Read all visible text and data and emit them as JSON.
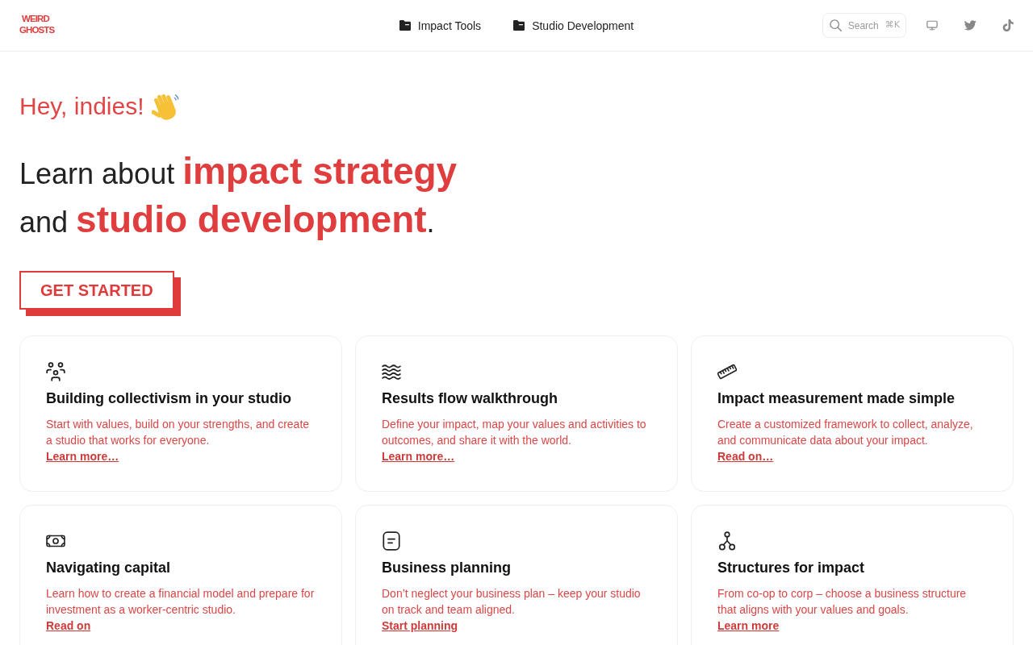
{
  "logo": {
    "lines": [
      "WEIRD",
      "GHOSTS"
    ]
  },
  "nav": [
    {
      "label": "Impact Tools"
    },
    {
      "label": "Studio Development"
    }
  ],
  "search": {
    "label": "Search",
    "shortcut": "⌘K"
  },
  "hero": {
    "greeting": "Hey, indies!",
    "headline": "Learn about **impact strategy** and **studio development**.",
    "button": "GET STARTED"
  },
  "cards": [
    {
      "title": "Building collectivism in your studio",
      "description": "Start with values, build on your strengths, and create a studio that works for everyone.",
      "link": "Learn more…"
    },
    {
      "title": "Results flow walkthrough",
      "description": "Define your impact, map your values and activities to outcomes, and share it with the world.",
      "link": "Learn more…"
    },
    {
      "title": "Impact measurement made simple",
      "description": "Create a customized framework to collect, analyze, and communicate data about your impact.",
      "link": "Read on…"
    },
    {
      "title": "Navigating capital",
      "description": "Learn how to create a financial model and prepare for investment as a worker-centric studio.",
      "link": "Read on"
    },
    {
      "title": "Business planning",
      "description": "Don’t neglect your business plan – keep your studio on track and team aligned.",
      "link": "Start planning"
    },
    {
      "title": "Structures for impact",
      "description": "From co-op to corp – choose a business structure that aligns with your values and goals.",
      "link": "Learn more"
    }
  ]
}
